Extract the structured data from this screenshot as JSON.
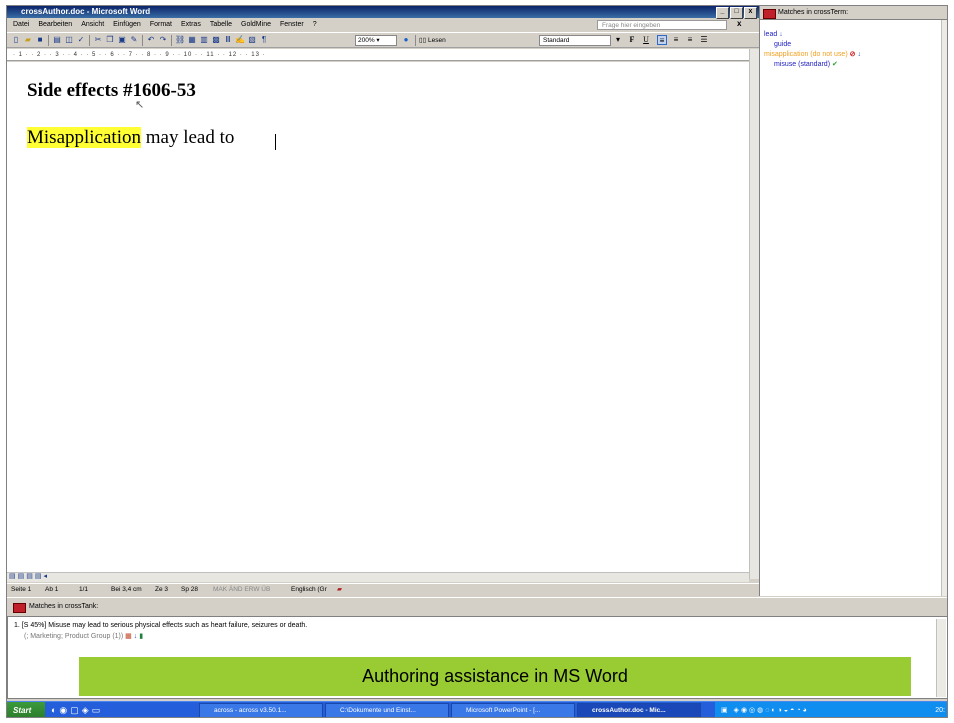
{
  "window": {
    "title": "crossAuthor.doc - Microsoft Word",
    "help_placeholder": "Frage hier eingeben",
    "close_label": "x",
    "controls": [
      "_",
      "□",
      "x"
    ]
  },
  "menu": [
    "Datei",
    "Bearbeiten",
    "Ansicht",
    "Einfügen",
    "Format",
    "Extras",
    "Tabelle",
    "GoldMine",
    "Fenster",
    "?"
  ],
  "toolbar": {
    "zoom": "200%",
    "read_label": "Lesen",
    "style": "Standard",
    "bold": "F",
    "underline": "U"
  },
  "ruler": "· 1 · · 2 · · 3 · · 4 · · 5 · · 6 · · 7 · · 8 · · 9 · · 10 · · 11 · · 12 · · 13 ·",
  "document": {
    "heading": "Side effects #1606-53",
    "highlighted_word": "Misapplication",
    "rest_text": " may lead to "
  },
  "status": {
    "seite": "Seite 1",
    "ab": "Ab 1",
    "pages": "1/1",
    "bei": "Bei 3,4 cm",
    "ze": "Ze 3",
    "sp": "Sp 28",
    "flags": "MAK  ÄND  ERW  ÜB",
    "language": "Englisch (Gr"
  },
  "term_pane": {
    "title": "Matches in crossTerm:",
    "items": [
      {
        "text": "lead",
        "color": "#2020c0",
        "indent": 0
      },
      {
        "text": "guide",
        "color": "#2020c0",
        "indent": 1
      },
      {
        "text": "misapplication (do not use)",
        "color": "#f0a020",
        "indent": 0,
        "badge": "⊘"
      },
      {
        "text": "misuse (standard)",
        "color": "#2020c0",
        "indent": 1,
        "badge": "✔"
      }
    ]
  },
  "tank_pane": {
    "title": "Matches in crossTank:",
    "result": "1. [S 45%] Misuse may lead to serious physical effects such as heart failure, seizures or death.",
    "meta": "(; Marketing; Product Group (1))"
  },
  "caption": "Authoring assistance in MS Word",
  "taskbar": {
    "start": "Start",
    "buttons": [
      {
        "label": "across - across v3.50.1...",
        "active": false
      },
      {
        "label": "C:\\Dokumente und Einst...",
        "active": false
      },
      {
        "label": "Microsoft PowerPoint - [...",
        "active": false
      },
      {
        "label": "crossAuthor.doc - Mic...",
        "active": true
      }
    ],
    "clock": "20:"
  }
}
